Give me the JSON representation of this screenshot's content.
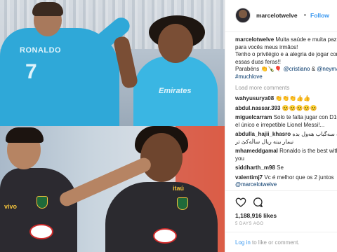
{
  "header": {
    "username": "marcelotwelve",
    "separator": "•",
    "follow_label": "Follow"
  },
  "caption": {
    "username": "marcelotwelve",
    "line1": "Muita saúde e muita paz",
    "line2": "para vocês meus irmãos!",
    "line3": "Tenho o privilégio e a alegria de jogar com",
    "line4": "essas duas feras!!",
    "line5_prefix": "Parabéns 👏🍾🎈 ",
    "mention1": "@cristiano",
    "line5_mid": " & ",
    "mention2": "@neymarjr",
    "hashtag": "#muchlove"
  },
  "load_more_label": "Load more comments",
  "comments": [
    {
      "user": "wahyusurya08",
      "text": "👏👏👏👍👍"
    },
    {
      "user": "abdul.nassar.393",
      "text": "😊😊😊😊😊"
    },
    {
      "user": "miguelcarram",
      "text": "Solo te falta jugar con D10S",
      "text2": "el único e irrepetible Lionel Messi!..."
    },
    {
      "user": "abdulla_hajii_khasro",
      "text": "نه سەگباب هەول بدە",
      "text2": "نیمار بینە ریال ساڵەکێ تر"
    },
    {
      "user": "mhameddgamal",
      "text": "Ronaldo is the best with",
      "text2": "you"
    },
    {
      "user": "siddharth_m98",
      "text": "Se"
    },
    {
      "user": "valentimj7",
      "text": "Vc é melhor que os 2 juntos",
      "text2": "@marcelotwelve"
    }
  ],
  "post": {
    "likes": "1,188,916 likes",
    "age": "5 DAYS AGO"
  },
  "login": {
    "link": "Log in",
    "rest": " to like or comment."
  },
  "photo": {
    "jersey_name": "RONALDO",
    "jersey_number": "7",
    "sponsor_top": "Emirates",
    "sponsor_bottom_left": "vivo",
    "sponsor_bottom_right": "itaú"
  },
  "colors": {
    "accent": "#3897f0",
    "text": "#262626",
    "muted": "#999999",
    "border": "#efefef"
  }
}
